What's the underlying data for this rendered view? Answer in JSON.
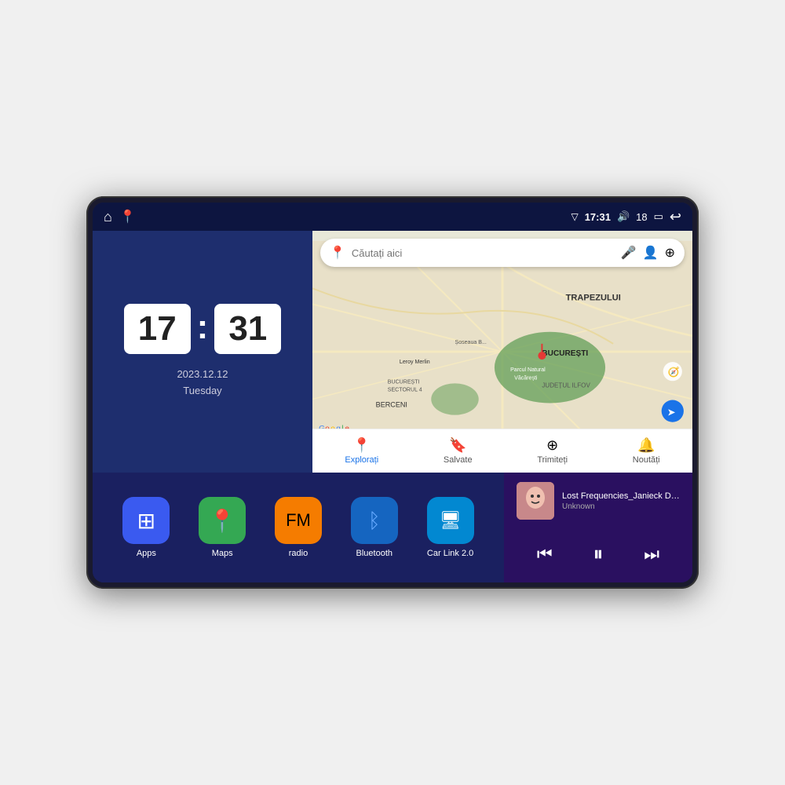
{
  "device": {
    "status_bar": {
      "signal_icon": "▽",
      "time": "17:31",
      "volume_icon": "🔊",
      "battery_level": "18",
      "battery_icon": "▭",
      "back_icon": "↩"
    },
    "clock": {
      "hour": "17",
      "minute": "31",
      "date": "2023.12.12",
      "day": "Tuesday"
    },
    "map": {
      "search_placeholder": "Căutați aici",
      "nav_items": [
        {
          "label": "Explorați",
          "active": true
        },
        {
          "label": "Salvate",
          "active": false
        },
        {
          "label": "Trimiteți",
          "active": false
        },
        {
          "label": "Noutăți",
          "active": false
        }
      ],
      "place_labels": [
        "BUCUREȘTI",
        "JUDEȚUL ILFOV",
        "TRAPEZULUI",
        "BERCENI",
        "Parcul Natural Văcărești",
        "Leroy Merlin",
        "BUCUREȘTI SECTORUL 4"
      ]
    },
    "apps": [
      {
        "label": "Apps",
        "icon": "⊞",
        "bg": "#3a5af0"
      },
      {
        "label": "Maps",
        "icon": "📍",
        "bg": "#34a853"
      },
      {
        "label": "radio",
        "icon": "📻",
        "bg": "#f57c00"
      },
      {
        "label": "Bluetooth",
        "icon": "🔷",
        "bg": "#1565c0"
      },
      {
        "label": "Car Link 2.0",
        "icon": "🖥",
        "bg": "#0288d1"
      }
    ],
    "music": {
      "title": "Lost Frequencies_Janieck Devy-...",
      "artist": "Unknown",
      "thumb_alt": "album-art"
    },
    "home_icon": "⌂",
    "maps_status_icon": "📍"
  }
}
